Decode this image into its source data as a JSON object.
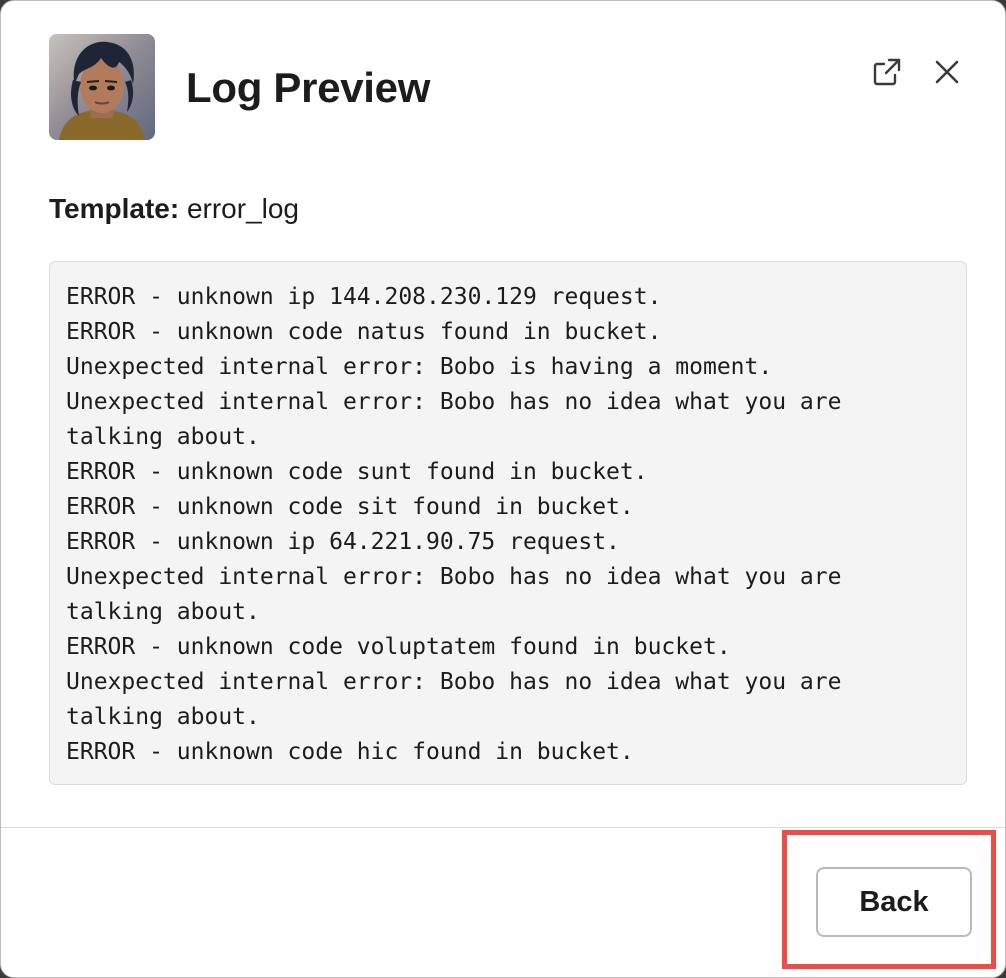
{
  "modal": {
    "title": "Log Preview",
    "avatar_icon": "user-avatar",
    "header_icons": [
      "external-link-icon",
      "close-icon"
    ]
  },
  "template": {
    "label": "Template:",
    "value": "error_log"
  },
  "log": {
    "lines": [
      "ERROR - unknown ip 144.208.230.129 request.",
      "ERROR - unknown code natus found in bucket.",
      "Unexpected internal error: Bobo is having a moment.",
      "Unexpected internal error: Bobo has no idea what you are talking about.",
      "ERROR - unknown code sunt found in bucket.",
      "ERROR - unknown code sit found in bucket.",
      "ERROR - unknown ip 64.221.90.75 request.",
      "Unexpected internal error: Bobo has no idea what you are talking about.",
      "ERROR - unknown code voluptatem found in bucket.",
      "Unexpected internal error: Bobo has no idea what you are talking about.",
      "ERROR - unknown code hic found in bucket."
    ]
  },
  "footer": {
    "back_label": "Back"
  },
  "colors": {
    "highlight": "#ea4e48",
    "text": "#1d1c1d",
    "log_background": "#f4f4f4"
  }
}
